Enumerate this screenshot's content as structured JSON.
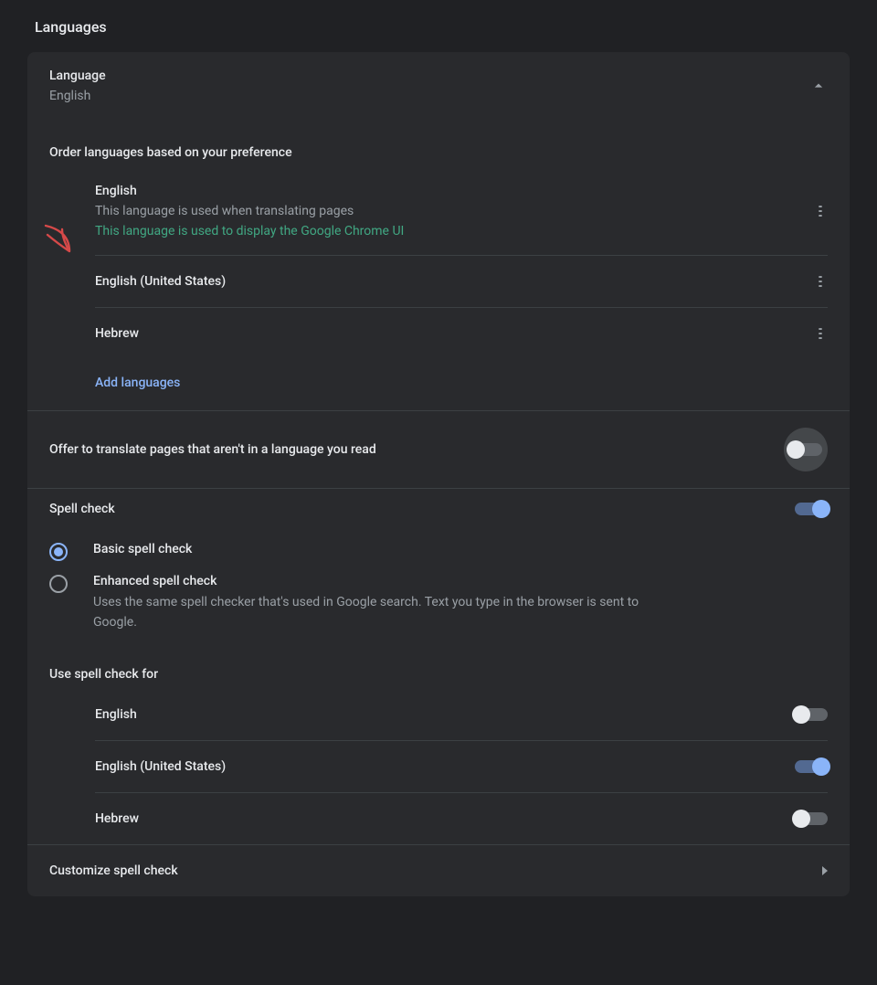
{
  "page": {
    "title": "Languages"
  },
  "language_section": {
    "title": "Language",
    "current": "English",
    "order_label": "Order languages based on your preference",
    "items": [
      {
        "name": "English",
        "note": "This language is used when translating pages",
        "accent_note": "This language is used to display the Google Chrome UI"
      },
      {
        "name": "English (United States)"
      },
      {
        "name": "Hebrew"
      }
    ],
    "add_label": "Add languages",
    "offer_translate_label": "Offer to translate pages that aren't in a language you read",
    "offer_translate_on": false
  },
  "spell_check": {
    "title": "Spell check",
    "enabled": true,
    "options": [
      {
        "label": "Basic spell check",
        "description": "",
        "selected": true
      },
      {
        "label": "Enhanced spell check",
        "description": "Uses the same spell checker that's used in Google search. Text you type in the browser is sent to Google.",
        "selected": false
      }
    ],
    "use_for_label": "Use spell check for",
    "languages": [
      {
        "name": "English",
        "on": false
      },
      {
        "name": "English (United States)",
        "on": true
      },
      {
        "name": "Hebrew",
        "on": false
      }
    ],
    "customize_label": "Customize spell check"
  }
}
